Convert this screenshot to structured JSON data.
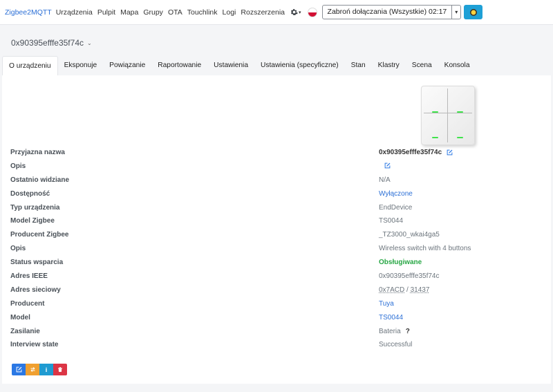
{
  "navbar": {
    "brand": "Zigbee2MQTT",
    "items": [
      "Urządzenia",
      "Pulpit",
      "Mapa",
      "Grupy",
      "OTA",
      "Touchlink",
      "Logi",
      "Rozszerzenia"
    ],
    "permit_join_label": "Zabroń dołączania (Wszystkie) 02:17"
  },
  "device": {
    "title": "0x90395efffe35f74c"
  },
  "tabs": [
    "O urządzeniu",
    "Eksponuje",
    "Powiązanie",
    "Raportowanie",
    "Ustawienia",
    "Ustawienia (specyficzne)",
    "Stan",
    "Klastry",
    "Scena",
    "Konsola"
  ],
  "details": {
    "friendly_name": {
      "label": "Przyjazna nazwa",
      "value": "0x90395efffe35f74c"
    },
    "description": {
      "label": "Opis"
    },
    "last_seen": {
      "label": "Ostatnio widziane",
      "value": "N/A"
    },
    "availability": {
      "label": "Dostępność",
      "value": "Wyłączone"
    },
    "device_type": {
      "label": "Typ urządzenia",
      "value": "EndDevice"
    },
    "zigbee_model": {
      "label": "Model Zigbee",
      "value": "TS0044"
    },
    "zigbee_manufacturer": {
      "label": "Producent Zigbee",
      "value": "_TZ3000_wkai4ga5"
    },
    "model_description": {
      "label": "Opis",
      "value": "Wireless switch with 4 buttons"
    },
    "support_status": {
      "label": "Status wsparcia",
      "value": "Obsługiwane"
    },
    "ieee_address": {
      "label": "Adres IEEE",
      "value": "0x90395efffe35f74c"
    },
    "network_address": {
      "label": "Adres sieciowy",
      "hex": "0x7ACD",
      "separator": " / ",
      "dec": "31437"
    },
    "manufacturer": {
      "label": "Producent",
      "value": "Tuya"
    },
    "model": {
      "label": "Model",
      "value": "TS0044"
    },
    "power": {
      "label": "Zasilanie",
      "value": "Bateria",
      "help": "?"
    },
    "interview_state": {
      "label": "Interview state",
      "value": "Successful"
    }
  },
  "colors": {
    "brand": "#2b6fd6",
    "link": "#2b6fd6",
    "supported": "#28a745",
    "led": "#3ee34a",
    "btn_edit": "#2b78e4",
    "btn_rename": "#f0a030",
    "btn_info": "#1f9bd1",
    "btn_delete": "#dc3545"
  },
  "icons": {
    "settings": "gear-icon",
    "language": "polish-flag-icon",
    "theme": "sun-icon",
    "edit": "edit-icon",
    "rename": "exchange-icon",
    "info": "info-icon",
    "delete": "trash-icon"
  },
  "actions": {
    "info_glyph": "i"
  }
}
